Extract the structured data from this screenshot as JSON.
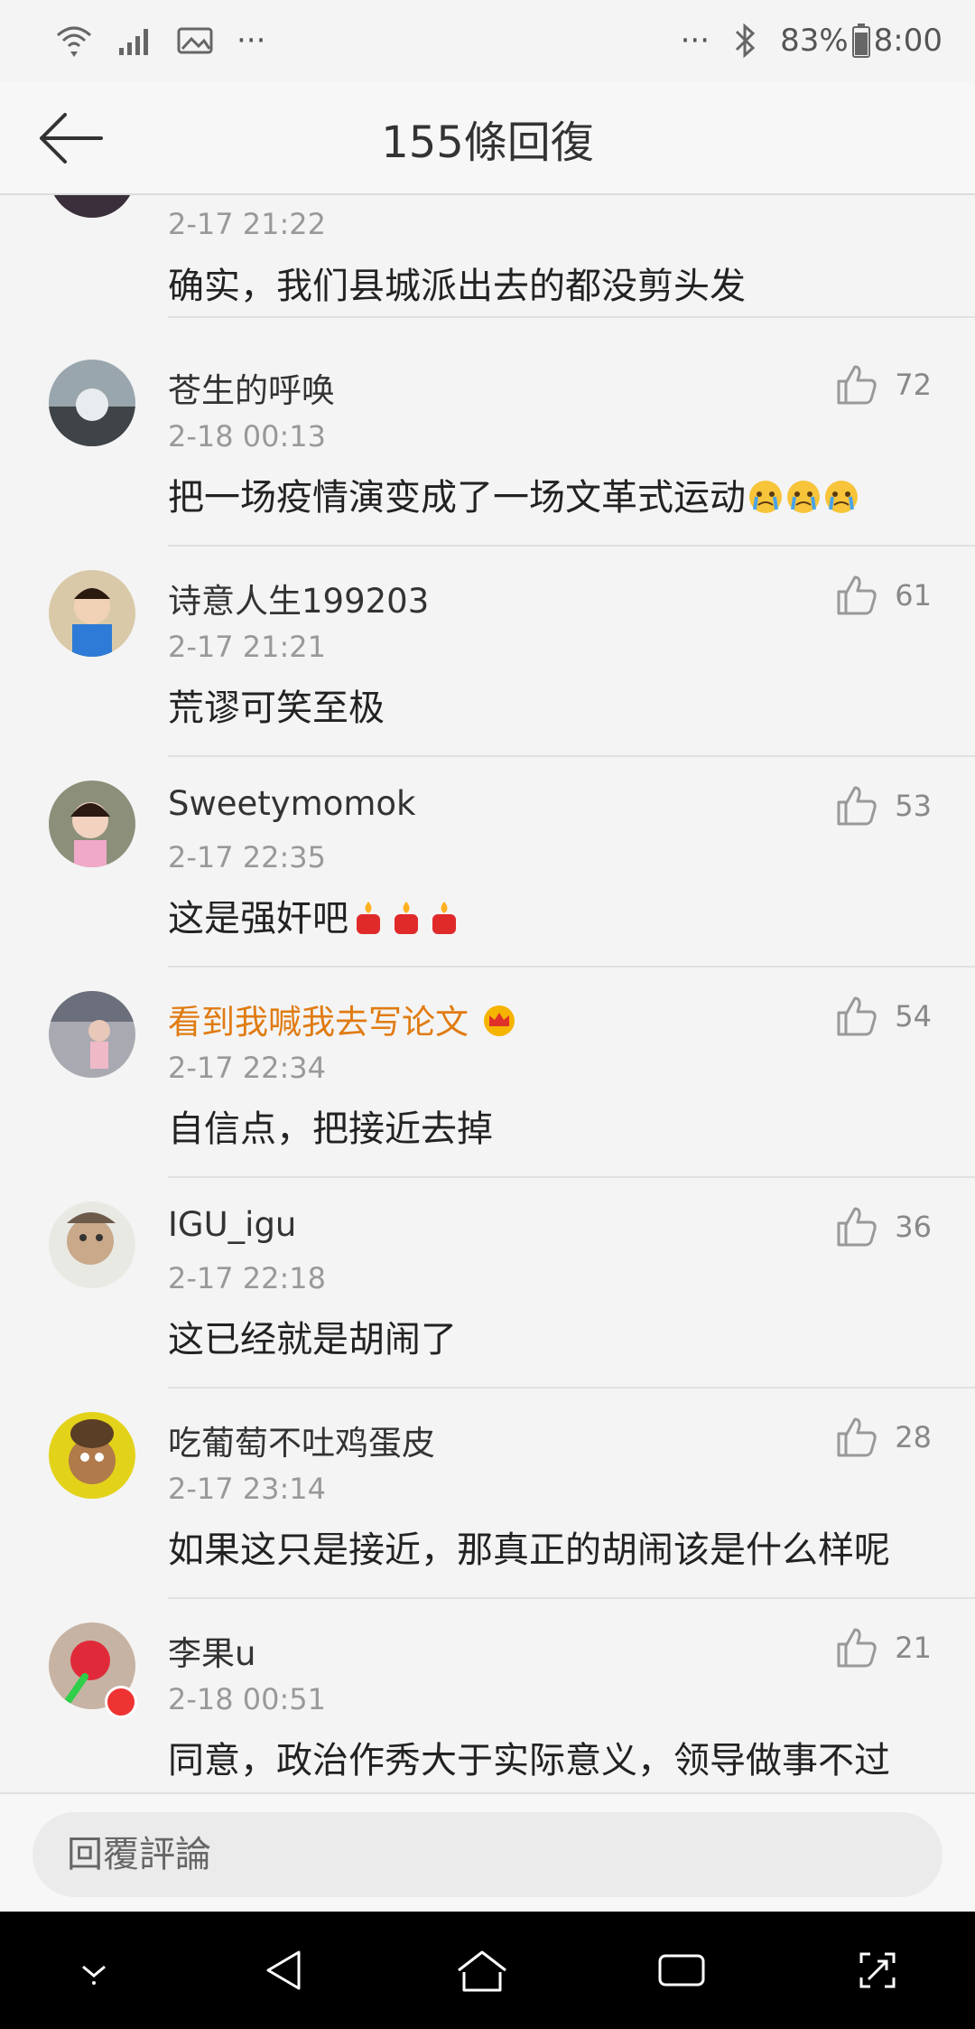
{
  "status_bar": {
    "battery": "83%",
    "time": "8:00",
    "left_more": "···",
    "right_more": "···"
  },
  "header": {
    "title": "155條回復"
  },
  "top_partial": {
    "time": "2-17 21:22",
    "comment": "确实，我们县城派出去的都没剪头发"
  },
  "comments": [
    {
      "username": "苍生的呼唤",
      "time": "2-18 00:13",
      "text": "把一场疫情演变成了一场文革式运动",
      "likes": "72",
      "emoji": "crying-face-icon",
      "emoji_count": 3
    },
    {
      "username": "诗意人生199203",
      "time": "2-17 21:21",
      "text": "荒谬可笑至极",
      "likes": "61"
    },
    {
      "username": "Sweetymomok",
      "time": "2-17 22:35",
      "text": "这是强奸吧",
      "likes": "53",
      "emoji": "candle-icon",
      "emoji_count": 3
    },
    {
      "username": "看到我喊我去写论文",
      "time": "2-17 22:34",
      "text": "自信点，把接近去掉",
      "likes": "54",
      "highlight": true,
      "badge": "crown-icon"
    },
    {
      "username": "IGU_igu",
      "time": "2-17 22:18",
      "text": "这已经就是胡闹了",
      "likes": "36"
    },
    {
      "username": "吃葡萄不吐鸡蛋皮",
      "time": "2-17 23:14",
      "text": "如果这只是接近，那真正的胡闹该是什么样呢",
      "likes": "28"
    },
    {
      "username": "李果u",
      "time": "2-18 00:51",
      "text": "同意，政治作秀大于实际意义，领导做事不过",
      "likes": "21"
    }
  ],
  "reply": {
    "placeholder": "回覆評論"
  },
  "colors": {
    "highlight_username": "#e07b12",
    "background": "#f4f4f4",
    "nav_bar": "#000000"
  }
}
